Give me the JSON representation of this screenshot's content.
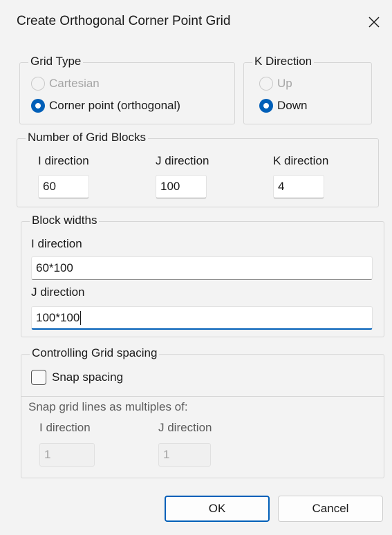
{
  "window": {
    "title": "Create Orthogonal Corner Point Grid",
    "close_icon": "close-icon"
  },
  "grid_type": {
    "label": "Grid Type",
    "options": [
      {
        "label": "Cartesian",
        "checked": false,
        "disabled": true
      },
      {
        "label": "Corner point (orthogonal)",
        "checked": true,
        "disabled": false
      }
    ]
  },
  "k_direction": {
    "label": "K Direction",
    "options": [
      {
        "label": "Up",
        "checked": false,
        "disabled": true
      },
      {
        "label": "Down",
        "checked": true,
        "disabled": false
      }
    ]
  },
  "grid_blocks": {
    "label": "Number of Grid Blocks",
    "i_label": "I direction",
    "i_value": "60",
    "j_label": "J direction",
    "j_value": "100",
    "k_label": "K direction",
    "k_value": "4"
  },
  "block_widths": {
    "label": "Block widths",
    "i_label": "I direction",
    "i_value": "60*100",
    "j_label": "J direction",
    "j_value": "100*100"
  },
  "grid_spacing": {
    "label": "Controlling Grid spacing",
    "snap_label": "Snap spacing",
    "snap_checked": false,
    "multiples_label": "Snap grid lines as multiples of:",
    "i_label": "I direction",
    "i_value": "1",
    "j_label": "J direction",
    "j_value": "1"
  },
  "buttons": {
    "ok": "OK",
    "cancel": "Cancel"
  },
  "colors": {
    "accent": "#005fb8",
    "background": "#f3f3f3"
  }
}
